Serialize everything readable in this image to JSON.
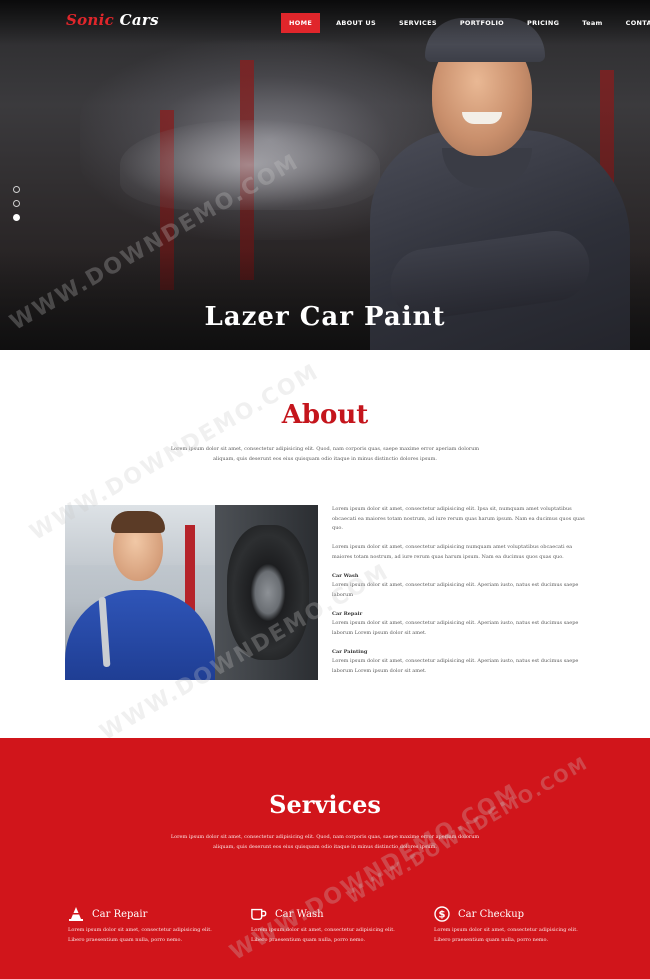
{
  "brand": {
    "name_part1": "Sonic",
    "name_part2": "Cars",
    "accent": "#d1151b"
  },
  "nav": {
    "items": [
      {
        "label": "HOME",
        "active": true
      },
      {
        "label": "ABOUT US",
        "active": false
      },
      {
        "label": "SERVICES",
        "active": false
      },
      {
        "label": "PORTFOLIO",
        "active": false
      },
      {
        "label": "PRICING",
        "active": false
      },
      {
        "label": "Team",
        "active": false
      },
      {
        "label": "CONTACT US",
        "active": false
      }
    ]
  },
  "hero": {
    "title": "Lazer Car Paint",
    "slides": 3,
    "active_slide": 3
  },
  "about": {
    "title": "About",
    "intro": "Lorem ipsum dolor sit amet, consectetur adipisicing elit. Quod, nam corporis quas, saepe maxime error aperiam dolorum aliquam, quis deserunt eos eius quisquam odio itaque in minus distinctio dolores ipsum.",
    "para1": "Lorem ipsum dolor sit amet, consectetur adipisicing elit. Ipsa sit, numquam amet voluptatibus obcaecati ea maiores totam nostrum, ad iure rerum quas harum ipsum. Nam ea ducimus quos quas quo.",
    "para2": "Lorem ipsum dolor sit amet, consectetur adipisicing numquam amet voluptatibus obcaecati ea maiores totam nostrum, ad iure rerum quas harum ipsum. Nam ea ducimus quos quas quo.",
    "items": [
      {
        "title": "Car Wash",
        "body": "Lorem ipsum dolor sit amet, consectetur adipisicing elit. Aperiam iusto, natus est ducimus saepe laborum"
      },
      {
        "title": "Car Repair",
        "body": "Lorem ipsum dolor sit amet, consectetur adipisicing elit. Aperiam iusto, natus est ducimus saepe laborum Lorem ipsum dolor sit amet."
      },
      {
        "title": "Car Painting",
        "body": "Lorem ipsum dolor sit amet, consectetur adipisicing elit. Aperiam iusto, natus est ducimus saepe laborum Lorem ipsum dolor sit amet."
      }
    ]
  },
  "services": {
    "title": "Services",
    "intro": "Lorem ipsum dolor sit amet, consectetur adipisicing elit. Quod, nam corporis quas, saepe maxime error aperiam dolorum aliquam, quis deserunt eos eius quisquam odio itaque in minus distinctio dolores ipsum.",
    "items": [
      {
        "icon": "cone-icon",
        "title": "Car Repair",
        "body": "Lorem ipsum dolor sit amet, consectetur adipisicing elit. Libero praesentium quam nulla, porro nemo."
      },
      {
        "icon": "cup-icon",
        "title": "Car Wash",
        "body": "Lorem ipsum dolor sit amet, consectetur adipisicing elit. Libero praesentium quam nulla, porro nemo."
      },
      {
        "icon": "dollar-icon",
        "title": "Car Checkup",
        "body": "Lorem ipsum dolor sit amet, consectetur adipisicing elit. Libero praesentium quam nulla, porro nemo."
      }
    ]
  },
  "watermark": "WWW.DOWNDEMO.COM"
}
